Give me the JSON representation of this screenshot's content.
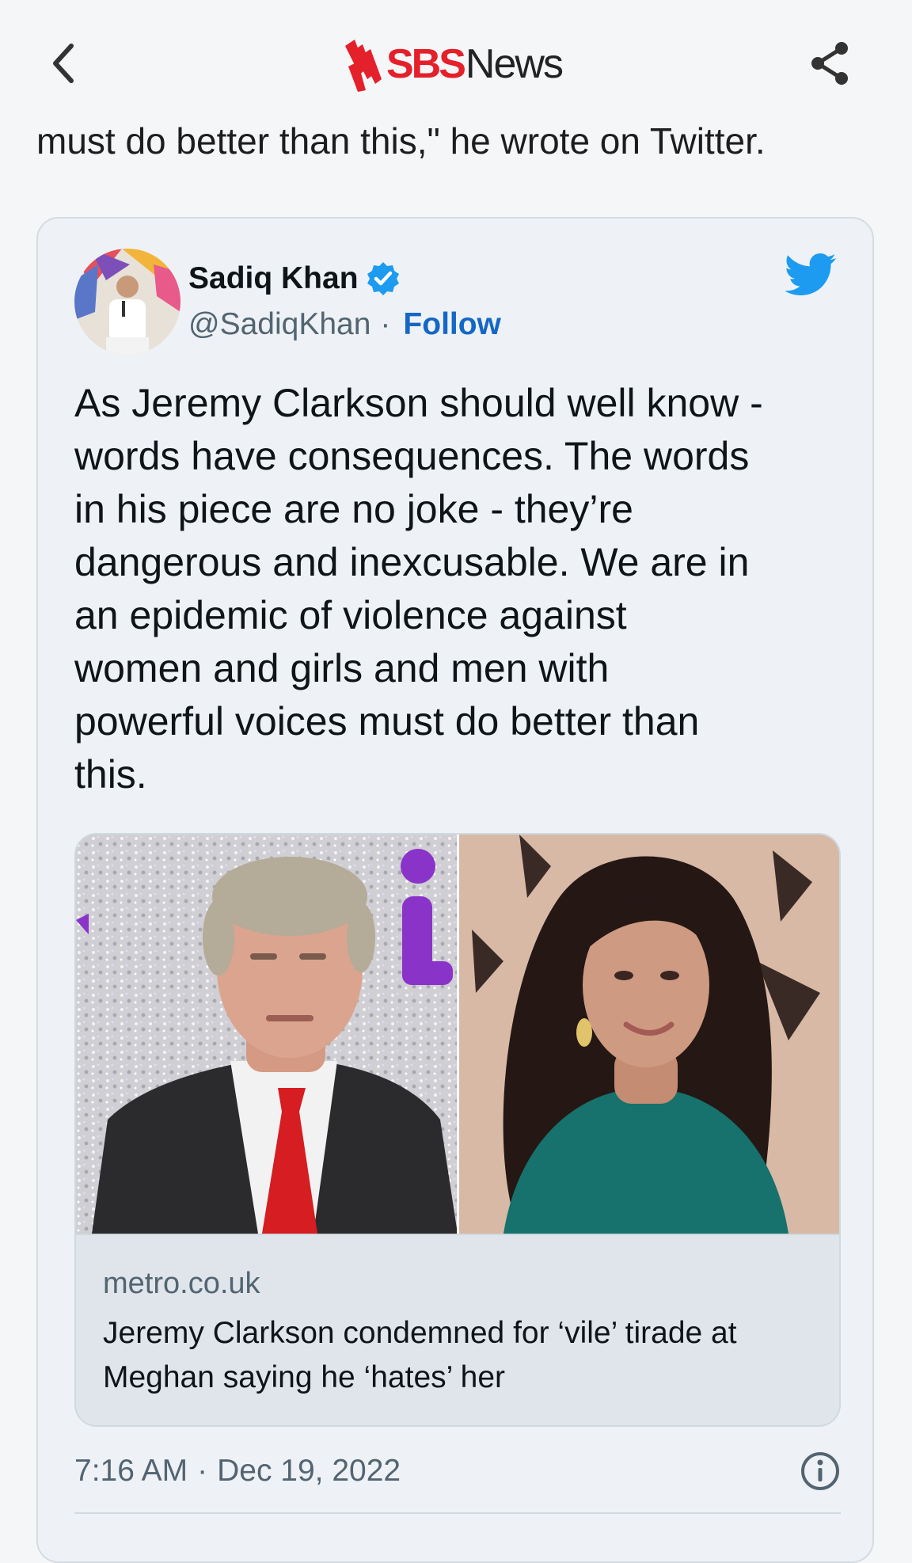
{
  "header": {
    "logo_sbs": "SBS",
    "logo_news": "News",
    "back_icon": "chevron-left-icon",
    "share_icon": "share-icon"
  },
  "article": {
    "text": "must do better than this,\" he wrote on Twitter."
  },
  "tweet": {
    "author_name": "Sadiq Khan",
    "handle": "@SadiqKhan",
    "separator": "·",
    "follow_label": "Follow",
    "text": "As Jeremy Clarkson should well know -\nwords have consequences. The words\nin his piece are no joke - they’re\ndangerous and inexcusable. We are in\nan epidemic of violence against\nwomen and girls and men with\npowerful voices must do better than\nthis.",
    "link_card": {
      "domain": "metro.co.uk",
      "title": "Jeremy Clarkson condemned for ‘vile’ tirade at Meghan saying he ‘hates’ her"
    },
    "time": "7:16 AM",
    "date": "Dec 19, 2022",
    "icons": [
      "verified-icon",
      "twitter-bird-icon",
      "info-icon"
    ]
  },
  "colors": {
    "brand_red": "#e4202a",
    "link_blue": "#1467c5",
    "twitter_blue": "#1d9bf0",
    "muted_text": "#536471"
  }
}
